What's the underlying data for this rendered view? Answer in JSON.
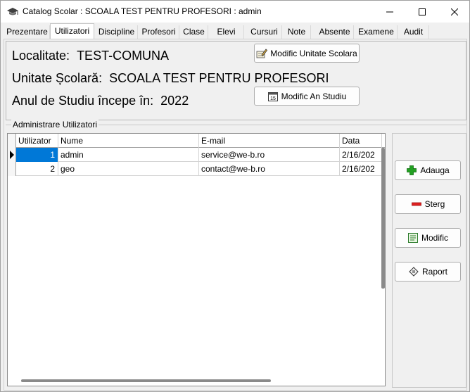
{
  "window": {
    "title": "Catalog Scolar : SCOALA TEST PENTRU PROFESORI : admin"
  },
  "tabs": [
    {
      "label": "Prezentare"
    },
    {
      "label": "Utilizatori"
    },
    {
      "label": "Discipline"
    },
    {
      "label": "Profesori"
    },
    {
      "label": "Clase"
    },
    {
      "label": "Elevi"
    },
    {
      "label": "Cursuri"
    },
    {
      "label": "Note"
    },
    {
      "label": "Absente"
    },
    {
      "label": "Examene"
    },
    {
      "label": "Audit"
    }
  ],
  "active_tab": "Utilizatori",
  "info": {
    "localitate_label": "Localitate:",
    "localitate_value": "TEST-COMUNA",
    "unitate_label": "Unitate Școlară:",
    "unitate_value": "SCOALA TEST PENTRU PROFESORI",
    "an_label": "Anul de Studiu începe în:",
    "an_value": "2022",
    "modify_unit_label": "Modific Unitate Scolara",
    "modify_year_label": "Modific An Studiu"
  },
  "users_group": {
    "title": "Administrare Utilizatori",
    "columns": [
      "Utilizator",
      "Nume",
      "E-mail",
      "Data"
    ],
    "rows": [
      {
        "id": "1",
        "name": "admin",
        "email": "service@we-b.ro",
        "date": "2/16/202"
      },
      {
        "id": "2",
        "name": "geo",
        "email": "contact@we-b.ro",
        "date": "2/16/202"
      }
    ]
  },
  "actions": {
    "add_label": "Adauga",
    "delete_label": "Sterg",
    "modify_label": "Modific",
    "report_label": "Raport"
  },
  "colors": {
    "selection": "#0078d7",
    "add_icon": "#22a022",
    "delete_icon": "#e02020"
  }
}
